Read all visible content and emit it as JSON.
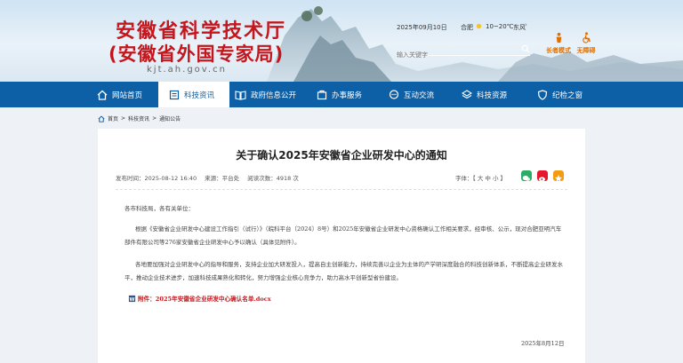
{
  "header": {
    "title": "安徽省科学技术厅",
    "subtitle": "(安徽省外国专家局)",
    "url": "kjt.ah.gov.cn",
    "date": "2025年09月10日",
    "city": "合肥",
    "temp": "10~20℃",
    "wind": "东风",
    "search_placeholder": "输入关键字",
    "accessibility": [
      "长者模式",
      "无障碍"
    ]
  },
  "nav": {
    "items": [
      {
        "label": "网站首页",
        "icon": "home-icon"
      },
      {
        "label": "科技资讯",
        "icon": "news-icon"
      },
      {
        "label": "政府信息公开",
        "icon": "book-icon"
      },
      {
        "label": "办事服务",
        "icon": "service-icon"
      },
      {
        "label": "互动交流",
        "icon": "chat-icon"
      },
      {
        "label": "科技资源",
        "icon": "resource-icon"
      },
      {
        "label": "纪检之窗",
        "icon": "shield-icon"
      }
    ],
    "active": "科技资讯"
  },
  "breadcrumb": [
    "首页",
    "科技资讯",
    "通知公告"
  ],
  "article": {
    "title": "关于确认2025年安徽省企业研发中心的通知",
    "publish_time": "发布时间：2025-08-12 16:40",
    "source": "来源：平台处",
    "views": "阅读次数：4918 次",
    "font_size_label": "字体：【 大 中 小 】",
    "greeting": "各市科技局，各有关单位：",
    "para1": "根据《安徽省企业研发中心建设工作指引（试行）》（皖科平台〔2024〕8号）和2025年安徽省企业研发中心资格确认工作相关要求，经审核、公示，现对合肥亚明汽车部件有限公司等276家安徽省企业研发中心予以确认（具体见附件）。",
    "para2": "各地要加强对企业研发中心的指导和服务，支持企业加大研发投入，提高自主创新能力，持续完善以企业为主体的产学研深度融合的科技创新体系，不断提高企业研发水平，推动企业技术进步，加速科技成果熟化和转化，努力增强企业核心竞争力，助力高水平创新型省份建设。",
    "attachment": "附件：2025年安徽省企业研发中心确认名单.docx",
    "date": "2025年8月12日"
  },
  "colors": {
    "brand_red": "#c4161c",
    "nav_blue": "#0d5fa6",
    "accent_orange": "#e26e00"
  }
}
